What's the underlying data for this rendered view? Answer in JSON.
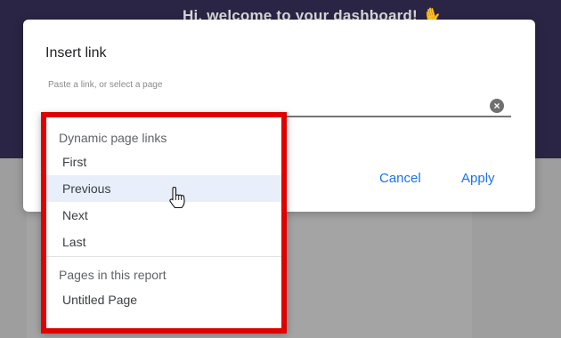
{
  "background": {
    "welcome_text": "Hi, welcome to your dashboard!",
    "wave_icon": "waving-hand-icon"
  },
  "dialog": {
    "title": "Insert link",
    "field_label": "Paste a link, or select a page",
    "field_value": "",
    "cancel_label": "Cancel",
    "apply_label": "Apply"
  },
  "dropdown": {
    "section_dynamic": "Dynamic page links",
    "dynamic_items": [
      "First",
      "Previous",
      "Next",
      "Last"
    ],
    "hovered_item": "Previous",
    "section_pages": "Pages in this report",
    "page_items": [
      "Untitled Page"
    ]
  },
  "colors": {
    "accent": "#1a73e8",
    "highlight_border": "#e00000",
    "hover_background": "#e8eefa",
    "header_background": "#1f1a3a"
  }
}
